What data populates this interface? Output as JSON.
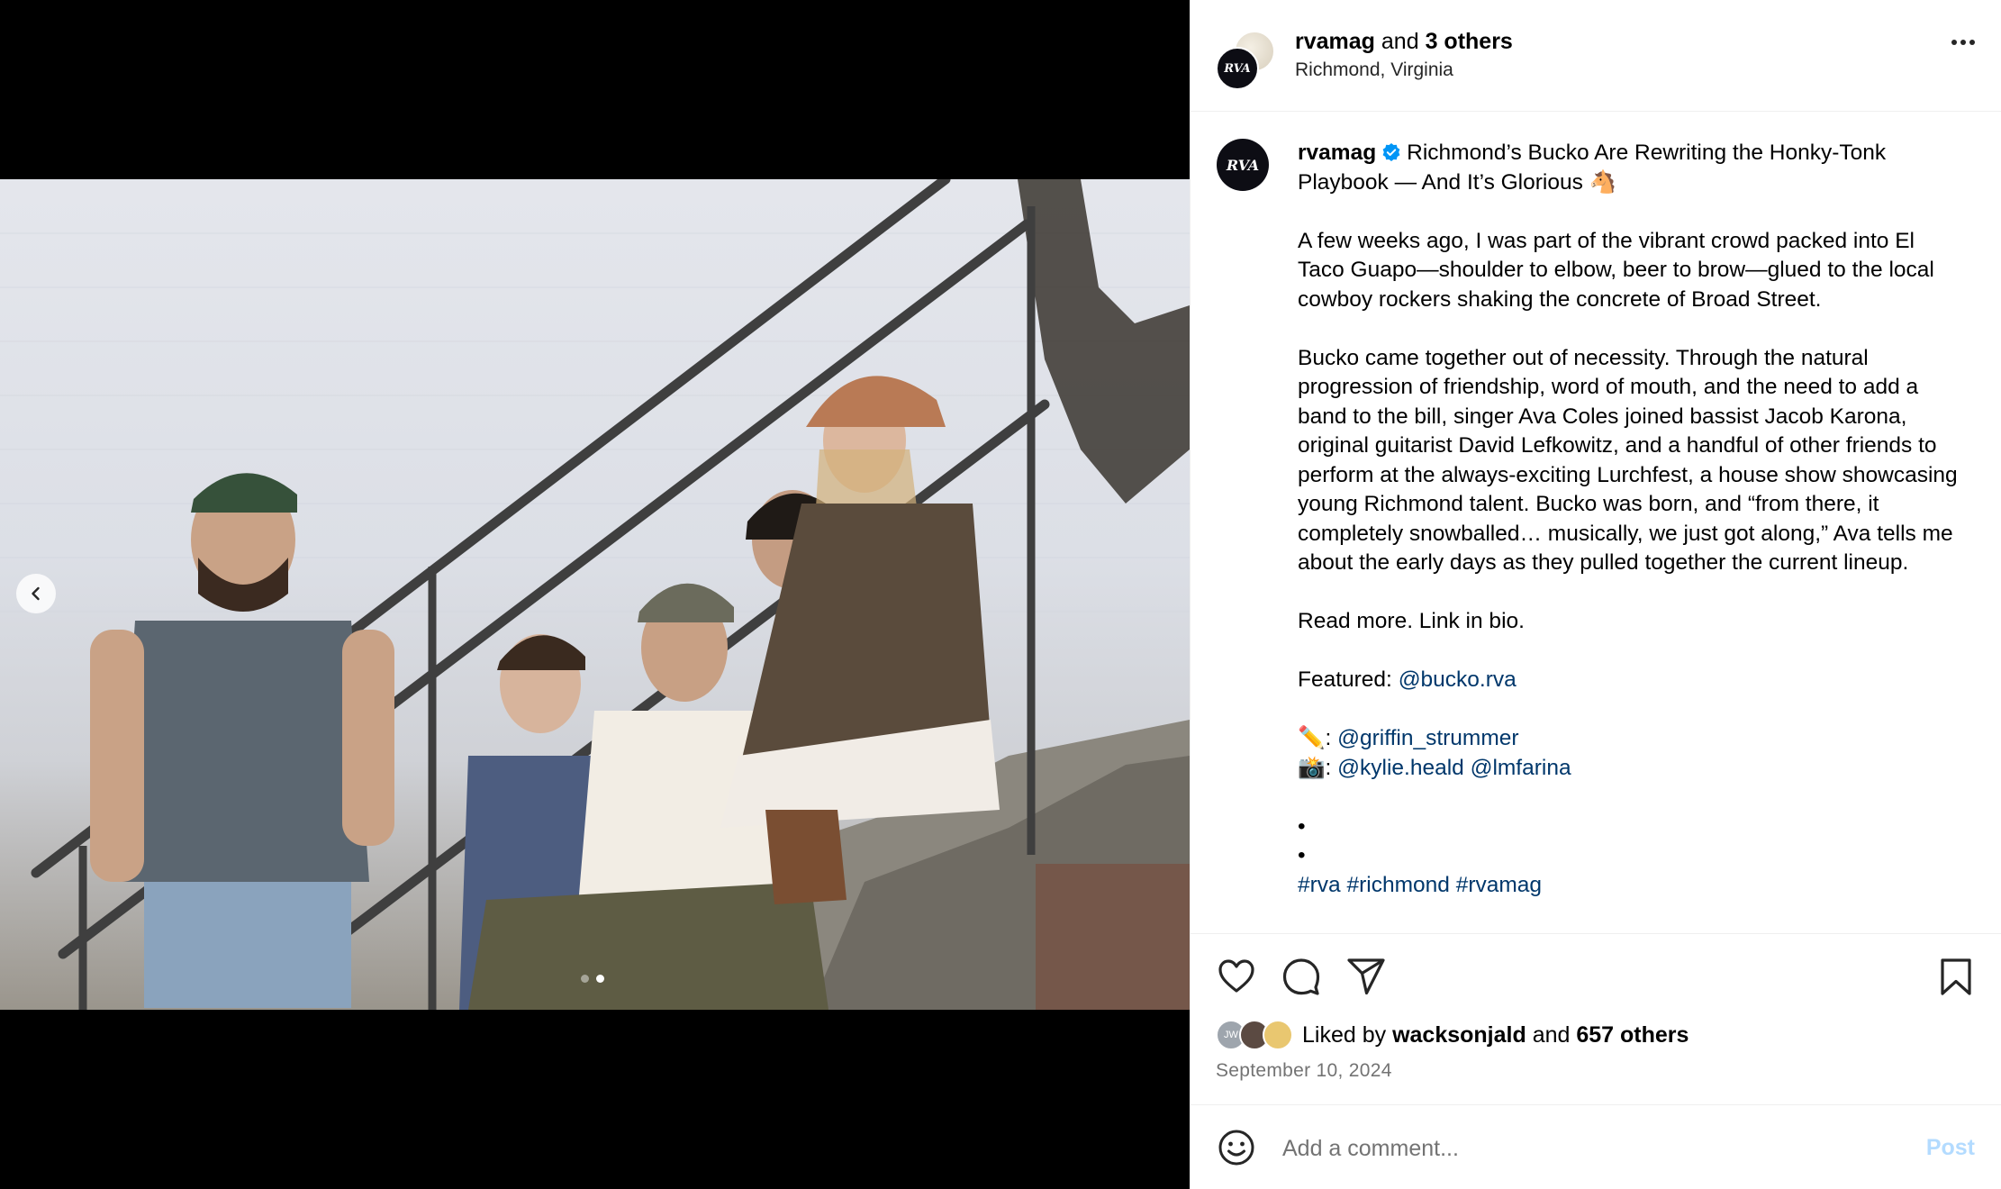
{
  "post": {
    "author": "rvamag",
    "coauthors_label": "and",
    "coauthors_count": "3 others",
    "location": "Richmond, Virginia",
    "avatar_initials": "RVA"
  },
  "caption": {
    "username": "rvamag",
    "headline": "Richmond’s Bucko Are Rewriting the Honky-Tonk Playbook — And It’s Glorious 🐴",
    "para1": "A few weeks ago, I was part of the vibrant crowd packed into El Taco Guapo—shoulder to elbow, beer to brow—glued to the local cowboy rockers shaking the concrete of Broad Street.",
    "para2": "Bucko came together out of necessity. Through the natural progression of friendship, word of mouth, and the need to add a band to the bill, singer Ava Coles joined bassist Jacob Karona, original guitarist David Lefkowitz, and a handful of other friends to perform at the always-exciting Lurchfest, a house show showcasing young Richmond talent. Bucko was born, and “from there, it completely snowballed… musically, we just got along,” Ava tells me about the early days as they pulled together the current lineup.",
    "read_more": "Read more. Link in bio.",
    "featured_label": "Featured:",
    "featured_handle": "@bucko.rva",
    "writer_emoji": "✏️:",
    "writer_handle": "@griffin_strummer",
    "photo_emoji": "📸:",
    "photo_handle_1": "@kylie.heald",
    "photo_handle_2": "@lmfarina",
    "bullet": "•",
    "hashtags": [
      "#rva",
      "#richmond",
      "#rvamag"
    ]
  },
  "likes": {
    "prefix": "Liked by",
    "user": "wacksonjald",
    "joiner": "and",
    "others": "657 others",
    "mini_avatar_1": "JW"
  },
  "date": "September 10, 2024",
  "comment": {
    "placeholder": "Add a comment...",
    "post_label": "Post"
  },
  "carousel": {
    "total": 2,
    "current": 2
  },
  "colors": {
    "link": "#00376b",
    "post_disabled": "#b3dbff",
    "verified": "#0095f6",
    "secondary_text": "#737373"
  },
  "icons": {
    "more": "more-options-icon",
    "like": "heart-icon",
    "comment": "comment-bubble-icon",
    "share": "paper-plane-icon",
    "save": "bookmark-icon",
    "emoji": "emoji-smiley-icon",
    "prev": "chevron-left-icon",
    "verified": "verified-badge-icon"
  }
}
